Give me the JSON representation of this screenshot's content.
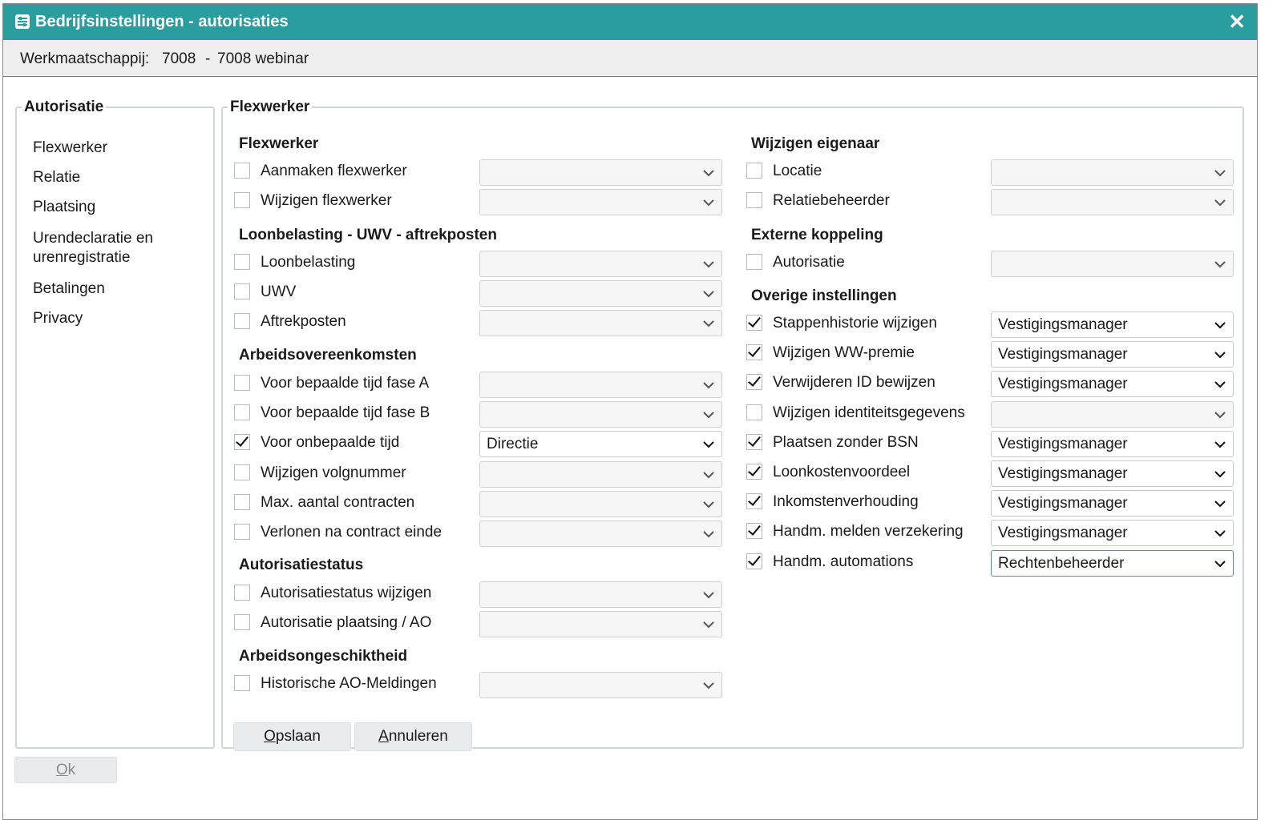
{
  "window": {
    "title": "Bedrijfsinstellingen - autorisaties",
    "close_glyph": "✕",
    "icon": "settings-icon",
    "accent_color": "#2a9d9f"
  },
  "subheader": {
    "label": "Werkmaatschappij:",
    "code": "7008",
    "separator": "-",
    "name": "7008 webinar"
  },
  "sidebar": {
    "legend": "Autorisatie",
    "items": [
      {
        "label": "Flexwerker"
      },
      {
        "label": "Relatie"
      },
      {
        "label": "Plaatsing"
      },
      {
        "label": "Urendeclaratie en urenregistratie"
      },
      {
        "label": "Betalingen"
      },
      {
        "label": "Privacy"
      }
    ]
  },
  "main": {
    "legend": "Flexwerker",
    "left": {
      "sections": [
        {
          "title": "Flexwerker",
          "rows": [
            {
              "label": "Aanmaken flexwerker",
              "checked": false,
              "value": ""
            },
            {
              "label": "Wijzigen flexwerker",
              "checked": false,
              "value": ""
            }
          ]
        },
        {
          "title": "Loonbelasting - UWV - aftrekposten",
          "rows": [
            {
              "label": "Loonbelasting",
              "checked": false,
              "value": ""
            },
            {
              "label": "UWV",
              "checked": false,
              "value": ""
            },
            {
              "label": "Aftrekposten",
              "checked": false,
              "value": ""
            }
          ]
        },
        {
          "title": "Arbeidsovereenkomsten",
          "rows": [
            {
              "label": "Voor bepaalde tijd fase A",
              "checked": false,
              "value": ""
            },
            {
              "label": "Voor bepaalde tijd fase B",
              "checked": false,
              "value": ""
            },
            {
              "label": "Voor onbepaalde tijd",
              "checked": true,
              "value": "Directie"
            },
            {
              "label": "Wijzigen volgnummer",
              "checked": false,
              "value": ""
            },
            {
              "label": "Max. aantal contracten",
              "checked": false,
              "value": ""
            },
            {
              "label": "Verlonen na contract einde",
              "checked": false,
              "value": ""
            }
          ]
        },
        {
          "title": "Autorisatiestatus",
          "rows": [
            {
              "label": "Autorisatiestatus wijzigen",
              "checked": false,
              "value": ""
            },
            {
              "label": "Autorisatie plaatsing / AO",
              "checked": false,
              "value": ""
            }
          ]
        },
        {
          "title": "Arbeidsongeschiktheid",
          "rows": [
            {
              "label": "Historische AO-Meldingen",
              "checked": false,
              "value": ""
            }
          ]
        }
      ]
    },
    "right": {
      "sections": [
        {
          "title": "Wijzigen eigenaar",
          "rows": [
            {
              "label": "Locatie",
              "checked": false,
              "value": ""
            },
            {
              "label": "Relatiebeheerder",
              "checked": false,
              "value": ""
            }
          ]
        },
        {
          "title": "Externe koppeling",
          "rows": [
            {
              "label": "Autorisatie",
              "checked": false,
              "value": ""
            }
          ]
        },
        {
          "title": "Overige instellingen",
          "rows": [
            {
              "label": "Stappenhistorie wijzigen",
              "checked": true,
              "value": "Vestigingsmanager"
            },
            {
              "label": "Wijzigen WW-premie",
              "checked": true,
              "value": "Vestigingsmanager"
            },
            {
              "label": "Verwijderen ID bewijzen",
              "checked": true,
              "value": "Vestigingsmanager"
            },
            {
              "label": "Wijzigen identiteitsgegevens",
              "checked": false,
              "value": ""
            },
            {
              "label": "Plaatsen zonder BSN",
              "checked": true,
              "value": "Vestigingsmanager"
            },
            {
              "label": "Loonkostenvoordeel",
              "checked": true,
              "value": "Vestigingsmanager"
            },
            {
              "label": "Inkomstenverhouding",
              "checked": true,
              "value": "Vestigingsmanager"
            },
            {
              "label": "Handm. melden verzekering",
              "checked": true,
              "value": "Vestigingsmanager"
            },
            {
              "label": "Handm. automations",
              "checked": true,
              "value": "Rechtenbeheerder"
            }
          ]
        }
      ]
    },
    "buttons": {
      "save": {
        "mnemonic": "O",
        "rest": "pslaan"
      },
      "cancel": {
        "mnemonic": "A",
        "rest": "nnuleren"
      }
    }
  },
  "footer": {
    "ok": {
      "mnemonic": "O",
      "rest": "k"
    }
  }
}
